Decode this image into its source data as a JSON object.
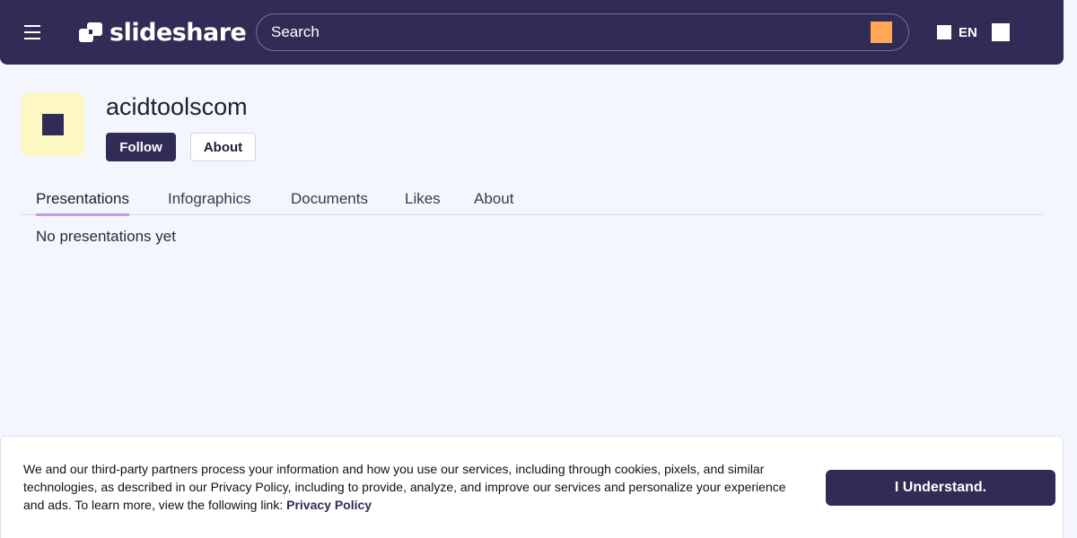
{
  "header": {
    "logo_text": "slideshare",
    "search_placeholder": "Search",
    "language": "EN"
  },
  "profile": {
    "username": "acidtoolscom",
    "follow_label": "Follow",
    "about_label": "About"
  },
  "tabs": [
    {
      "label": "Presentations",
      "active": true
    },
    {
      "label": "Infographics",
      "active": false
    },
    {
      "label": "Documents",
      "active": false
    },
    {
      "label": "Likes",
      "active": false
    },
    {
      "label": "About",
      "active": false
    }
  ],
  "content": {
    "empty_message": "No presentations yet"
  },
  "cookie_banner": {
    "text": "We and our third-party partners process your information and how you use our services, including through cookies, pixels, and similar technologies, as described in our Privacy Policy, including to provide, analyze, and improve our services and personalize your experience and ads. To learn more, view the following link: ",
    "link_label": "Privacy Policy",
    "button_label": "I Understand."
  },
  "colors": {
    "brand_dark": "#302c55",
    "search_accent": "#ffa756",
    "avatar_bg": "#fdf7c3",
    "active_tab_underline": "#c49be6",
    "page_bg": "#f4f6fd"
  }
}
